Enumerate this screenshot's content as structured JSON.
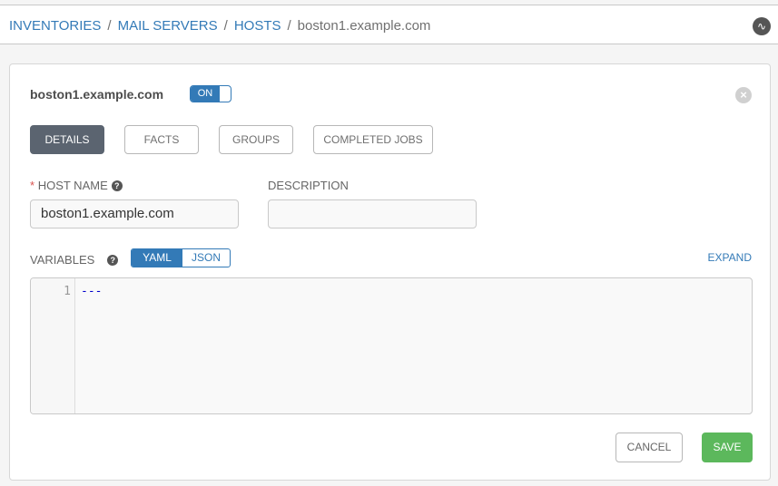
{
  "breadcrumb": {
    "items": [
      "INVENTORIES",
      "MAIL SERVERS",
      "HOSTS"
    ],
    "current": "boston1.example.com"
  },
  "header": {
    "activity_icon": "activity-stream-icon"
  },
  "host": {
    "title": "boston1.example.com",
    "enabled_label": "ON"
  },
  "tabs": [
    {
      "label": "DETAILS",
      "active": true
    },
    {
      "label": "FACTS"
    },
    {
      "label": "GROUPS"
    },
    {
      "label": "COMPLETED JOBS"
    }
  ],
  "form": {
    "host_name": {
      "required_mark": "*",
      "label": "HOST NAME",
      "value": "boston1.example.com"
    },
    "description": {
      "label": "DESCRIPTION",
      "value": ""
    },
    "variables": {
      "label": "VARIABLES",
      "modes": [
        "YAML",
        "JSON"
      ],
      "selected": "YAML",
      "expand_label": "EXPAND",
      "line_number": "1",
      "code": "---"
    }
  },
  "actions": {
    "cancel": "CANCEL",
    "save": "SAVE"
  },
  "colors": {
    "accent": "#337ab7",
    "save": "#5cb85c",
    "active_tab": "#5b6470"
  }
}
